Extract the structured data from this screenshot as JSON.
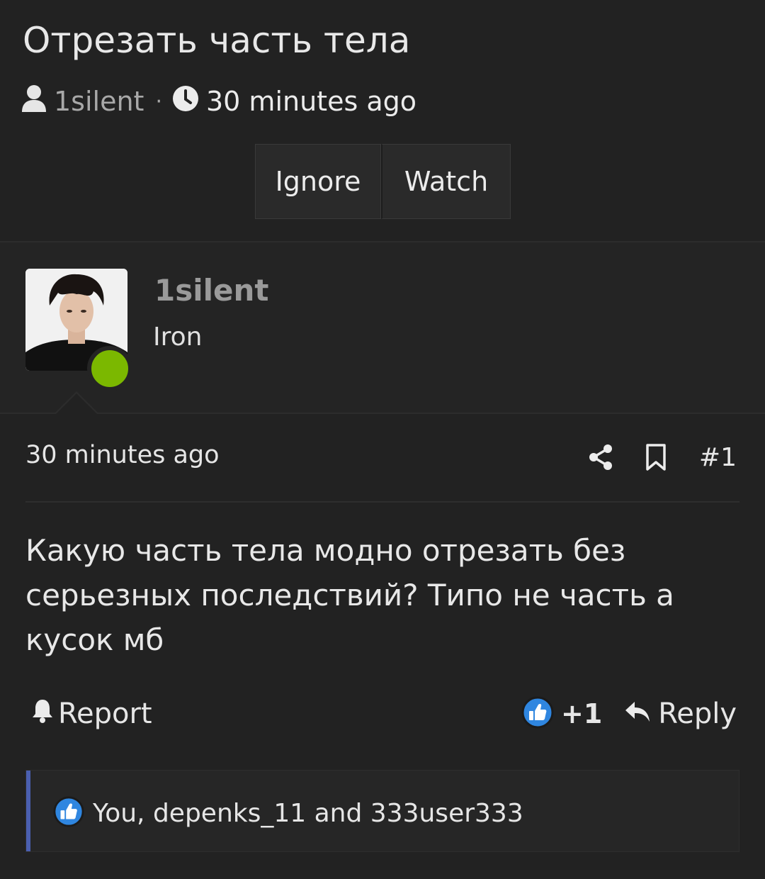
{
  "thread": {
    "title": "Отрезать часть тела",
    "author": "1silent",
    "separator": "·",
    "time": "30 minutes ago",
    "buttons": {
      "ignore": "Ignore",
      "watch": "Watch"
    }
  },
  "user": {
    "name": "1silent",
    "title": "Iron",
    "status": "online",
    "status_color": "#7bb800"
  },
  "post": {
    "time": "30 minutes ago",
    "number": "#1",
    "body": "Какую часть тела модно отрезать без серьезных последствий? Типо не часть а кусок мб",
    "report_label": "Report",
    "like_count": "+1",
    "reply_label": "Reply",
    "likes_text": "You, depenks_11 and 333user333"
  },
  "icons": {
    "author": "user-icon",
    "time": "clock-icon",
    "share": "share-icon",
    "bookmark": "bookmark-icon",
    "report": "bell-icon",
    "like": "thumbs-up-icon",
    "reply": "reply-icon"
  },
  "colors": {
    "background": "#222222",
    "accent": "#4a5fb0",
    "like_blue": "#2f86e0"
  }
}
